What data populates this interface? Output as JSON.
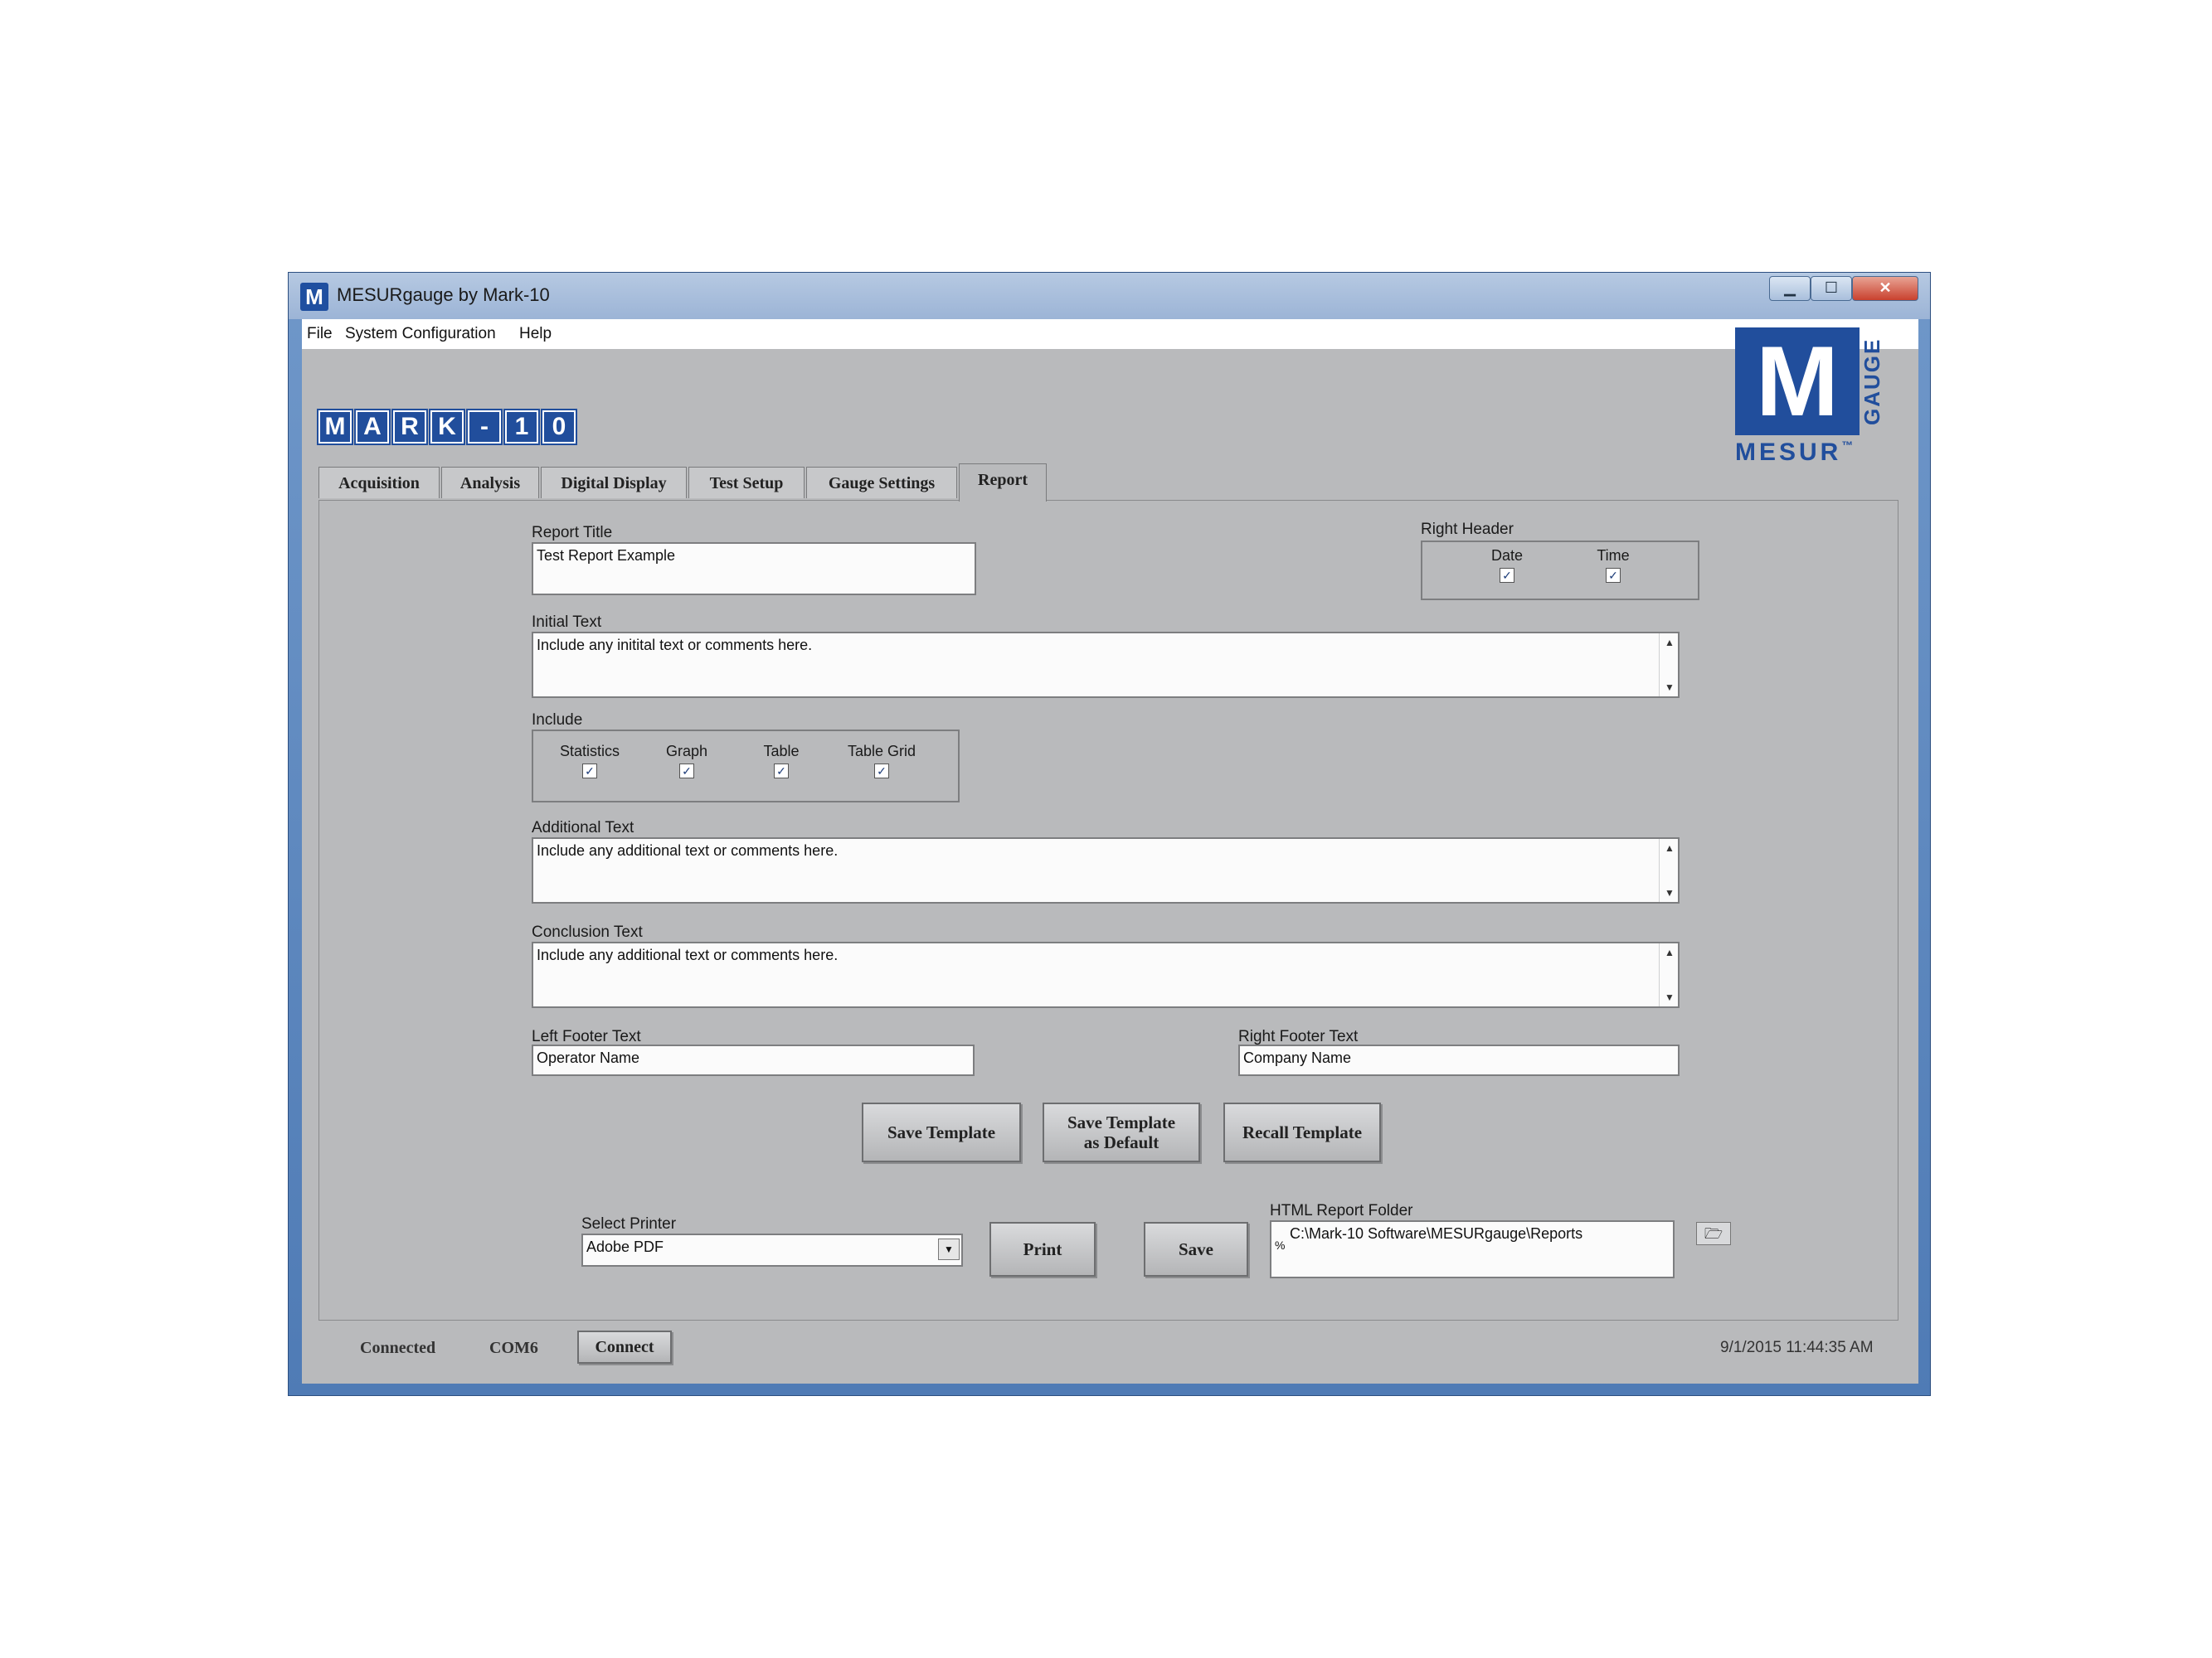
{
  "window": {
    "title": "MESURgauge by Mark-10",
    "app_icon": "M"
  },
  "window_controls": {
    "minimize": "▁",
    "maximize": "☐",
    "close": "✕"
  },
  "menu": [
    "File",
    "System Configuration",
    "Help"
  ],
  "logo": [
    "M",
    "A",
    "R",
    "K",
    "-",
    "1",
    "0"
  ],
  "brand": {
    "letter": "M",
    "word": "MESUR",
    "vertical": "GAUGE",
    "tm": "™"
  },
  "tabs": [
    "Acquisition",
    "Analysis",
    "Digital Display",
    "Test Setup",
    "Gauge Settings",
    "Report"
  ],
  "report": {
    "title_label": "Report Title",
    "title_value": "Test Report Example",
    "right_header_label": "Right Header",
    "right_header_items": [
      {
        "label": "Date",
        "checked": true
      },
      {
        "label": "Time",
        "checked": true
      }
    ],
    "initial_text_label": "Initial Text",
    "initial_text_value": "Include any initital text or comments here.",
    "include_label": "Include",
    "include_items": [
      {
        "label": "Statistics",
        "checked": true
      },
      {
        "label": "Graph",
        "checked": true
      },
      {
        "label": "Table",
        "checked": true
      },
      {
        "label": "Table Grid",
        "checked": true
      }
    ],
    "additional_text_label": "Additional Text",
    "additional_text_value": "Include any additional text or comments here.",
    "conclusion_text_label": "Conclusion Text",
    "conclusion_text_value": "Include any additional text or comments here.",
    "left_footer_label": "Left Footer Text",
    "left_footer_value": "Operator Name",
    "right_footer_label": "Right Footer Text",
    "right_footer_value": "Company Name",
    "buttons": {
      "save_template": "Save Template",
      "save_default_line1": "Save Template",
      "save_default_line2": "as Default",
      "recall_template": "Recall Template"
    },
    "printer_label": "Select Printer",
    "printer_value": "Adobe PDF",
    "print_button": "Print",
    "save_button": "Save",
    "folder_label": "HTML Report Folder",
    "folder_value": "C:\\Mark-10 Software\\MESURgauge\\Reports",
    "folder_prefix": "%"
  },
  "status": {
    "connection": "Connected",
    "port": "COM6",
    "connect_button": "Connect",
    "datetime": "9/1/2015 11:44:35 AM"
  },
  "icons": {
    "check": "✓",
    "scroll_up": "▲",
    "scroll_down": "▼",
    "dropdown": "▼",
    "folder": "🗁"
  },
  "colors": {
    "brand_blue": "#214e9c",
    "panel_gray": "#b9babc"
  }
}
